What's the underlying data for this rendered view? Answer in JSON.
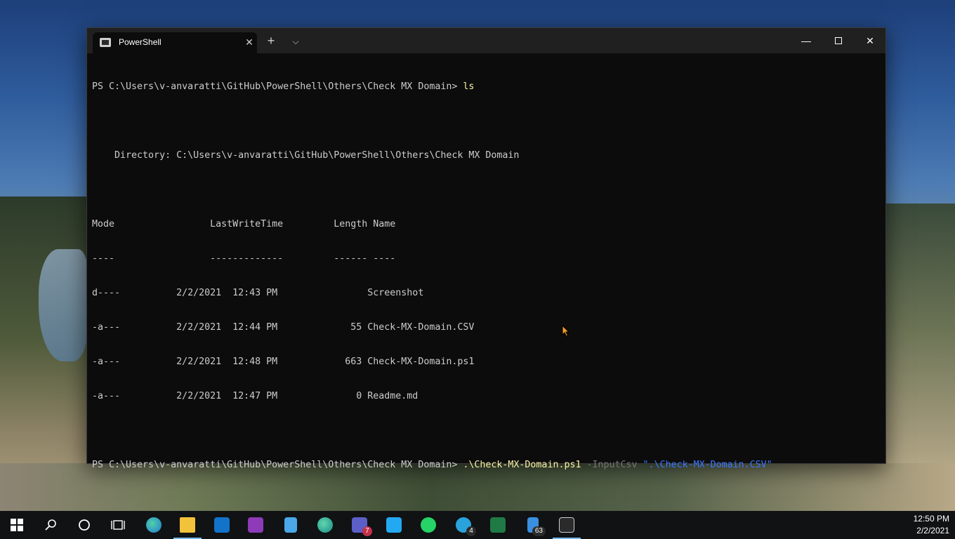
{
  "window": {
    "tab_title": "PowerShell",
    "tab_close": "✕",
    "new_tab": "+",
    "dropdown": "⌵",
    "minimize": "—",
    "close": "✕"
  },
  "terminal": {
    "prompt1": "PS C:\\Users\\v-anvaratti\\GitHub\\PowerShell\\Others\\Check MX Domain> ",
    "cmd1": "ls",
    "directory_line": "    Directory: C:\\Users\\v-anvaratti\\GitHub\\PowerShell\\Others\\Check MX Domain",
    "header": "Mode                 LastWriteTime         Length Name",
    "separator": "----                 -------------         ------ ----",
    "rows": [
      "d----          2/2/2021  12:43 PM                Screenshot",
      "-a---          2/2/2021  12:44 PM             55 Check-MX-Domain.CSV",
      "-a---          2/2/2021  12:48 PM            663 Check-MX-Domain.ps1",
      "-a---          2/2/2021  12:47 PM              0 Readme.md"
    ],
    "prompt2": "PS C:\\Users\\v-anvaratti\\GitHub\\PowerShell\\Others\\Check MX Domain> ",
    "cmd2_script": ".\\Check-MX-Domain.ps1",
    "cmd2_param": " -InputCsv ",
    "cmd2_arg": "\".\\Check-MX-Domain.CSV\""
  },
  "taskbar": {
    "items": [
      {
        "icon": "windows-start-icon",
        "color": "#ffffff"
      },
      {
        "icon": "search-icon",
        "color": "#ffffff"
      },
      {
        "icon": "cortana-icon",
        "color": "#ffffff"
      },
      {
        "icon": "task-view-icon",
        "color": "#ffffff"
      },
      {
        "icon": "edge-icon",
        "color": "#2fb3e0"
      },
      {
        "icon": "file-explorer-icon",
        "color": "#f3c23b"
      },
      {
        "icon": "outlook-icon",
        "color": "#1273c9"
      },
      {
        "icon": "onenote-icon",
        "color": "#8d3bb8"
      },
      {
        "icon": "azure-storage-icon",
        "color": "#4aa8e8"
      },
      {
        "icon": "edge-dev-icon",
        "color": "#2fb3a0"
      },
      {
        "icon": "teams-icon",
        "color": "#5b5fc7",
        "badge": "7"
      },
      {
        "icon": "vscode-icon",
        "color": "#23a9f2"
      },
      {
        "icon": "whatsapp-icon",
        "color": "#25d366"
      },
      {
        "icon": "telegram-icon",
        "color": "#2aa3dc",
        "badge": "4"
      },
      {
        "icon": "excel-icon",
        "color": "#1f7a45"
      },
      {
        "icon": "phone-icon",
        "color": "#3a8fe0",
        "badge": "63"
      },
      {
        "icon": "terminal-icon",
        "color": "#cccccc"
      }
    ],
    "clock_time": "12:50 PM",
    "clock_date": "2/2/2021"
  }
}
